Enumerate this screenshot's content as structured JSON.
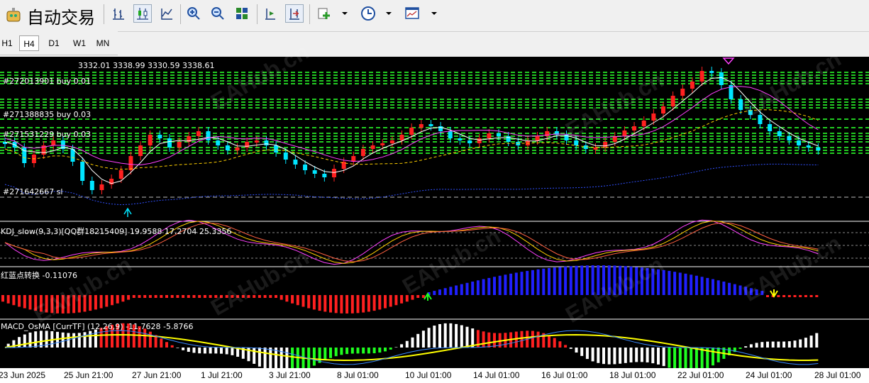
{
  "toolbar": {
    "app_title": "自动交易",
    "icons": [
      "candle-bar-icon",
      "candlestick-icon",
      "line-chart-icon",
      "zoom-in-icon",
      "zoom-out-icon",
      "tile-windows-icon",
      "chart-shift-icon",
      "autoscroll-icon",
      "add-indicator-icon",
      "clock-icon",
      "templates-icon"
    ]
  },
  "timeframes": [
    "H1",
    "H4",
    "D1",
    "W1",
    "MN"
  ],
  "active_timeframe": "H4",
  "chart": {
    "ohlc_text": "3332.01 3338.99 3330.59 3338.61",
    "order_labels": [
      "#272013901 buy 0.01",
      "#271388835 buy 0.03",
      "#271531229 buy 0.03",
      "#271642667 sl"
    ],
    "kdj_label": "KDJ_slow(9,3,3)[QQ群18215409] 19.9588 17.2704 25.3356",
    "redblue_label": "红蓝点转换 -0.11076",
    "macd_label": "MACD_OsMA [CurrTF] (12,26,9) -11.7628 -5.8766",
    "watermark": "EAHub.cn",
    "colors": {
      "bull": "#ff2020",
      "bear": "#00e5ff",
      "ma_white": "#ffffff",
      "ma_pink": "#ff40ff",
      "ma_yellow": "#ffd000",
      "ma_blue": "#3050ff",
      "order_line": "#22cc22"
    }
  },
  "x_axis": [
    "23 Jun 2025",
    "25 Jun 21:00",
    "27 Jun 21:00",
    "1 Jul 21:00",
    "3 Jul 21:00",
    "8 Jul 01:00",
    "10 Jul 01:00",
    "14 Jul 01:00",
    "16 Jul 01:00",
    "18 Jul 01:00",
    "22 Jul 01:00",
    "24 Jul 01:00",
    "28 Jul 01:00"
  ]
}
